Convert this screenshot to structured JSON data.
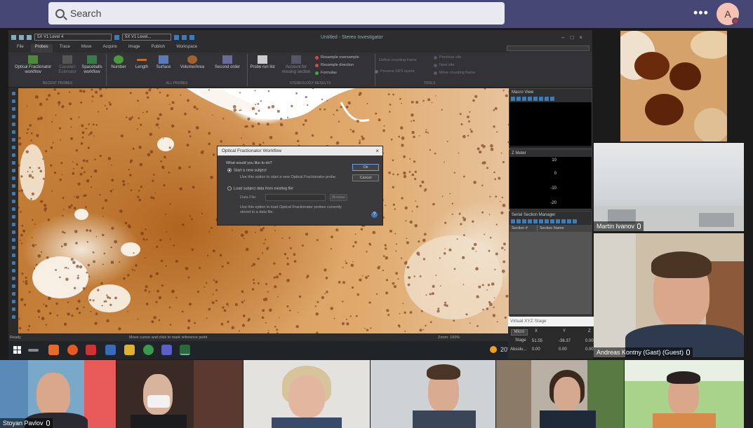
{
  "teams": {
    "search_placeholder": "Search",
    "more_label": "•••",
    "avatar_initial": "A"
  },
  "app": {
    "window_title": "Untitled - Stereo Investigator",
    "tb_box1": "5X V1 Level 4",
    "tb_box2": "5X V1 Level...",
    "menu_tabs": [
      "File",
      "Probes",
      "Trace",
      "Move",
      "Acquire",
      "Image",
      "Publish",
      "Workspace"
    ],
    "ribbon": {
      "optical_fractionator": "Optical Fractionator workflow",
      "cavalieri": "Cavalieri Estimator",
      "spaceballs": "Spaceballs workflow",
      "number": "Number",
      "length": "Length",
      "surface": "Surface",
      "volume_area": "Volume/Area",
      "second_order": "Second order",
      "probe_run_list": "Probe run list",
      "account_missing": "Account for missing section",
      "resample_oversample": "Resample oversample",
      "resample_direction": "Resample direction",
      "formulas": "Formulas",
      "define_counting_frame": "Define counting frame",
      "preview_srs": "Preview SRS layout",
      "previous_site": "Previous site",
      "next_site": "Next site",
      "move_counting_frame": "Move counting frame",
      "group_recent": "RECENT PROBES",
      "group_all": "ALL PROBES",
      "group_stereology": "STEREOLOGY RESULTS",
      "group_tools": "TOOLS"
    },
    "status_left": "Ready",
    "status_mid": "Move cursor and click to mark reference point",
    "status_zoom": "Zoom: 100%"
  },
  "dialog": {
    "title": "Optical Fractionator Workflow",
    "question": "What would you like to do?",
    "option1": "Start a new subject",
    "option1_desc": "Use this option to start a new Optical Fractionator probe.",
    "option2": "Load subject data from existing file",
    "data_file_label": "Data File:",
    "browse": "Browse",
    "option2_desc": "Use this option to load Optical Fractionator probes currently stored in a data file.",
    "ok": "Ok",
    "cancel": "Cancel",
    "help": "?"
  },
  "panels": {
    "macro_view": "Macro View",
    "z_meter": "Z Meter",
    "z_ticks": [
      "10",
      "0",
      "-10",
      "-20"
    ],
    "serial_section": "Serial Section Manager",
    "col1": "Section #",
    "col2": "Section Name"
  },
  "xyz": {
    "title": "Virtual XYZ Stage",
    "mode": "Micro",
    "x_label": "X",
    "y_label": "Y",
    "z_label": "Z",
    "stage_label": "Stage",
    "stage_x": "51.55",
    "stage_y": "-36.37",
    "stage_z": "0.00",
    "absolute_label": "Absolu...",
    "abs_x": "0.00",
    "abs_y": "0.00",
    "abs_z": "0.00"
  },
  "taskbar": {
    "temperature": "20°C"
  },
  "participants": {
    "martin": "Martin Ivanov",
    "andreas": "Andreas Kontny (Gast) (Guest)",
    "stoyan": "Stoyan Pavlov"
  }
}
